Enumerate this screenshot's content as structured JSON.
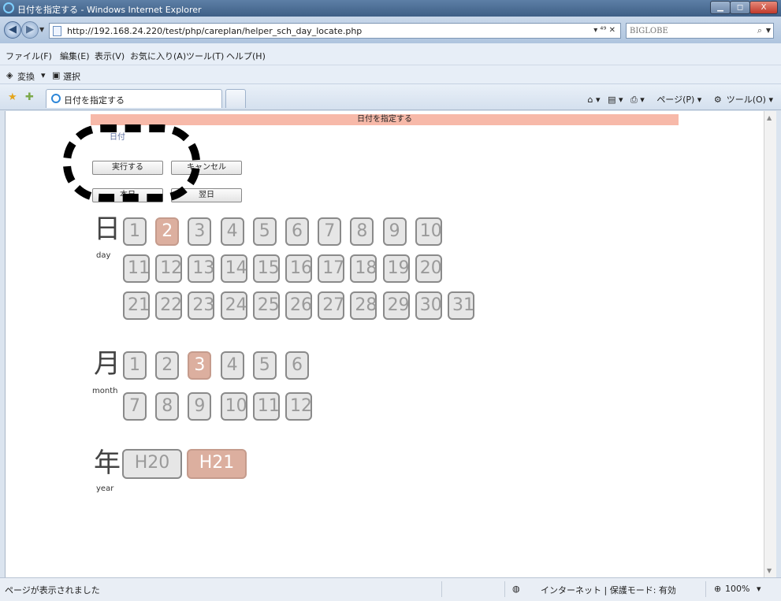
{
  "window": {
    "title": "日付を指定する - Windows Internet Explorer",
    "minimize": "▁",
    "maximize": "◻",
    "close": "X"
  },
  "address": {
    "url": "http://192.168.24.220/test/php/careplan/helper_sch_day_locate.php",
    "url_buttons": "▾ ⁴⁹ ✕"
  },
  "search": {
    "placeholder": "BIGLOBE"
  },
  "menu": [
    "ファイル(F)",
    "編集(E)",
    "表示(V)",
    "お気に入り(A)",
    "ツール(T)",
    "ヘルプ(H)"
  ],
  "linkbar": {
    "convert": "変換",
    "select": "選択"
  },
  "tab": {
    "label": "日付を指定する"
  },
  "commandbar": {
    "page": "ページ(P)",
    "tools": "ツール(O)"
  },
  "page": {
    "header": "日付を指定する",
    "top_link": "日付",
    "buttons": {
      "execute": "実行する",
      "cancel": "キャンセル",
      "today": "本日",
      "tomorrow": "翌日"
    },
    "day": {
      "label": "日",
      "sub": "day",
      "selected": 2,
      "rows": [
        [
          "1",
          "2",
          "3",
          "4",
          "5",
          "6",
          "7",
          "8",
          "9",
          "10"
        ],
        [
          "11",
          "12",
          "13",
          "14",
          "15",
          "16",
          "17",
          "18",
          "19",
          "20"
        ],
        [
          "21",
          "22",
          "23",
          "24",
          "25",
          "26",
          "27",
          "28",
          "29",
          "30",
          "31"
        ]
      ]
    },
    "month": {
      "label": "月",
      "sub": "month",
      "selected": 3,
      "rows": [
        [
          "1",
          "2",
          "3",
          "4",
          "5",
          "6"
        ],
        [
          "7",
          "8",
          "9",
          "10",
          "11",
          "12"
        ]
      ]
    },
    "year": {
      "label": "年",
      "sub": "year",
      "selected": "H21",
      "options": [
        "H20",
        "H21"
      ]
    }
  },
  "status": {
    "text": "ページが表示されました",
    "zone": "インターネット | 保護モード: 有効",
    "zoom": "100%"
  }
}
